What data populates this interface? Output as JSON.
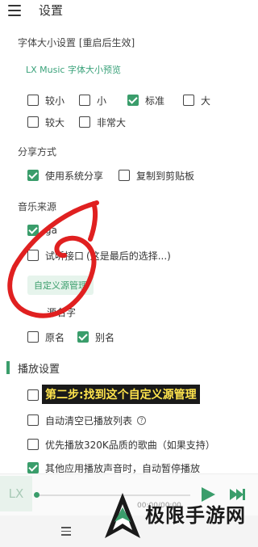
{
  "appbar": {
    "title": "设置"
  },
  "font_size": {
    "title": "字体大小设置 [重启后生效]",
    "preview": "LX Music 字体大小预览",
    "options": [
      {
        "label": "较小",
        "checked": false
      },
      {
        "label": "小",
        "checked": false
      },
      {
        "label": "标准",
        "checked": true
      },
      {
        "label": "大",
        "checked": false
      },
      {
        "label": "较大",
        "checked": false
      },
      {
        "label": "非常大",
        "checked": false
      }
    ]
  },
  "share": {
    "title": "分享方式",
    "options": [
      {
        "label": "使用系统分享",
        "checked": true
      },
      {
        "label": "复制到剪贴板",
        "checked": false
      }
    ]
  },
  "music_source": {
    "title": "音乐来源",
    "option1_partial": "ga",
    "option1_checked": true,
    "option2_label": "试听接口",
    "option2_suffix": "(这是最后的选择...)",
    "option2_checked": false,
    "custom_button": "自定义源管理"
  },
  "source_name": {
    "title_partial": "源名字",
    "options": [
      {
        "label": "原名",
        "checked": false
      },
      {
        "label": "别名",
        "checked": true
      }
    ]
  },
  "playback": {
    "title": "播放设置",
    "options": [
      {
        "label": "",
        "checked": false
      },
      {
        "label": "自动清空已播放列表",
        "checked": false
      },
      {
        "label": "优先播放320K品质的歌曲（如果支持）",
        "checked": false
      },
      {
        "label": "其他应用播放声音时，自动暂停播放",
        "checked": true
      }
    ]
  },
  "caption": "第二步:找到这个自定义源管理",
  "player": {
    "logo": "LX",
    "time": "00:00/00:00",
    "progress": 0
  },
  "watermark": {
    "text": "极限手游网"
  },
  "colors": {
    "accent": "#3a9d6b",
    "annotation": "#e02020",
    "caption_text": "#ffe44d"
  }
}
